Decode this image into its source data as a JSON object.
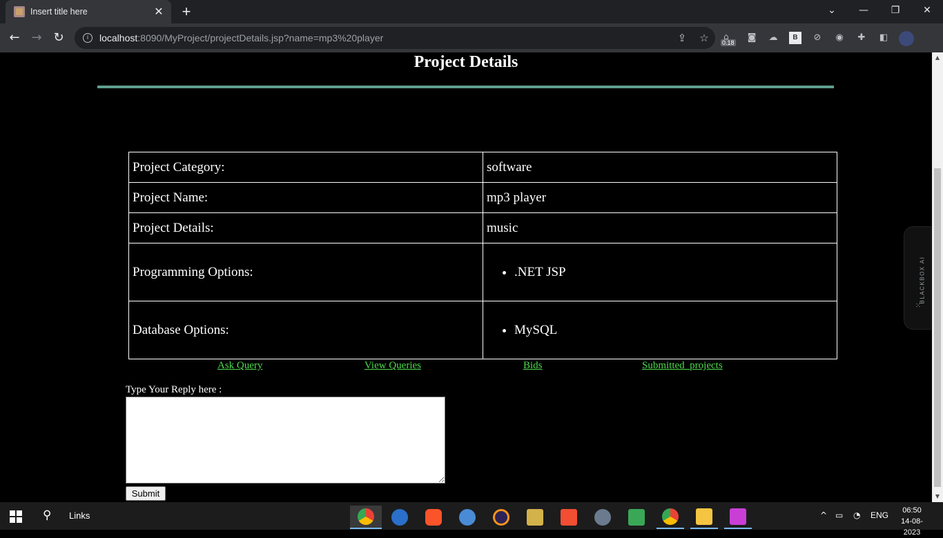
{
  "browser": {
    "tab_title": "Insert title here",
    "tab_close": "✕",
    "new_tab": "+",
    "url_host": "localhost",
    "url_rest": ":8090/MyProject/projectDetails.jsp?name=mp3%20player",
    "extension_badge": "0.18"
  },
  "page": {
    "title": "Project Details",
    "rows": [
      {
        "label": "Project Category:",
        "value": "software"
      },
      {
        "label": "Project Name:",
        "value": "mp3 player"
      },
      {
        "label": "Project Details:",
        "value": "music"
      },
      {
        "label": "Programming Options:",
        "value": ".NET JSP"
      },
      {
        "label": "Database Options:",
        "value": "MySQL"
      }
    ],
    "links": {
      "ask_query": "Ask Query",
      "view_queries": "View Queries",
      "bids": "Bids",
      "submitted_projects": "Submitted_projects"
    },
    "reply_label": "Type Your Reply here :",
    "reply_value": "",
    "submit_label": "Submit",
    "link_color": "#4ddb4d",
    "rule_color": "#5f9e8f"
  },
  "sidebar_widget": {
    "label": "BLACKBOX AI"
  },
  "taskbar": {
    "links_label": "Links",
    "language": "ENG",
    "time": "06:50",
    "date": "14-08-2023"
  }
}
